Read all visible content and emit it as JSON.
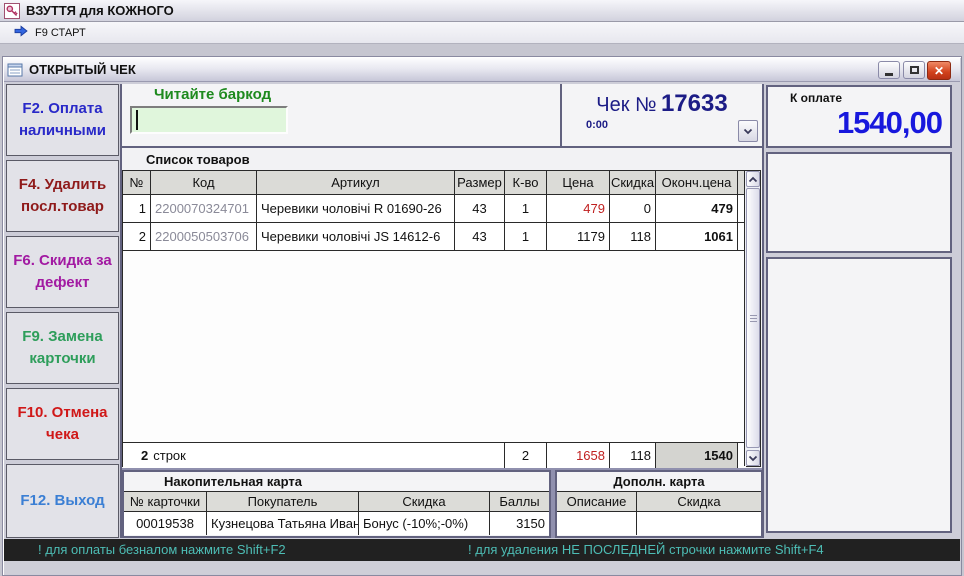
{
  "app": {
    "title": "ВЗУТТЯ для КОЖНОГО"
  },
  "toolbar": {
    "start_label": "F9 СТАРТ"
  },
  "check_window": {
    "title": "ОТКРЫТЫЙ ЧЕК",
    "barcode_label": "Читайте баркод",
    "barcode_value": "",
    "check_label": "Чек №",
    "check_number": "17633",
    "check_time": "0:00",
    "to_pay_label": "К оплате",
    "to_pay_amount": "1540,00"
  },
  "sidebar": {
    "buttons": [
      {
        "label": "F2. Оплата наличными",
        "color": "#2929c8"
      },
      {
        "label": "F4. Удалить посл.товар",
        "color": "#8f1a1a"
      },
      {
        "label": "F6. Скидка за дефект",
        "color": "#a21aa2"
      },
      {
        "label": "F9. Замена карточки",
        "color": "#2e9e5b"
      },
      {
        "label": "F10. Отмена чека",
        "color": "#d01818"
      },
      {
        "label": "F12. Выход",
        "color": "#3b7fd4"
      }
    ]
  },
  "items_table": {
    "title": "Список товаров",
    "columns": [
      "№",
      "Код",
      "Артикул",
      "Размер",
      "К-во",
      "Цена",
      "Скидка",
      "Оконч.цена"
    ],
    "rows": [
      {
        "num": "1",
        "code": "2200070324701",
        "article": "Черевики чоловічі R 01690-26",
        "size": "43",
        "qty": "1",
        "price": "479",
        "discount": "0",
        "final": "479"
      },
      {
        "num": "2",
        "code": "2200050503706",
        "article": "Черевики чоловічі JS 14612-6",
        "size": "43",
        "qty": "1",
        "price": "1179",
        "discount": "118",
        "final": "1061"
      }
    ],
    "totals": {
      "count": "2",
      "count_label": "строк",
      "qty": "2",
      "price": "1658",
      "discount": "118",
      "final": "1540"
    }
  },
  "loyalty_card": {
    "title": "Накопительная карта",
    "columns": [
      "№ карточки",
      "Покупатель",
      "Скидка",
      "Баллы"
    ],
    "row": {
      "card_number": "00019538",
      "customer": "Кузнецова Татьяна Иван",
      "discount": "Бонус (-10%;-0%)",
      "points": "3150"
    }
  },
  "extra_card": {
    "title": "Дополн. карта",
    "columns": [
      "Описание",
      "Скидка"
    ],
    "row": {
      "description": "",
      "discount": ""
    }
  },
  "status_bar": {
    "message1": "! для оплаты безналом нажмите Shift+F2",
    "message2": "! для удаления НЕ ПОСЛЕДНЕЙ строчки нажмите Shift+F4"
  },
  "colors": {
    "price_highlight": "#c02020",
    "check_navy": "#1c1c86",
    "amount_blue": "#1818dd",
    "barcode_green": "#1e8a1e",
    "status_teal": "#4dbdb5"
  }
}
